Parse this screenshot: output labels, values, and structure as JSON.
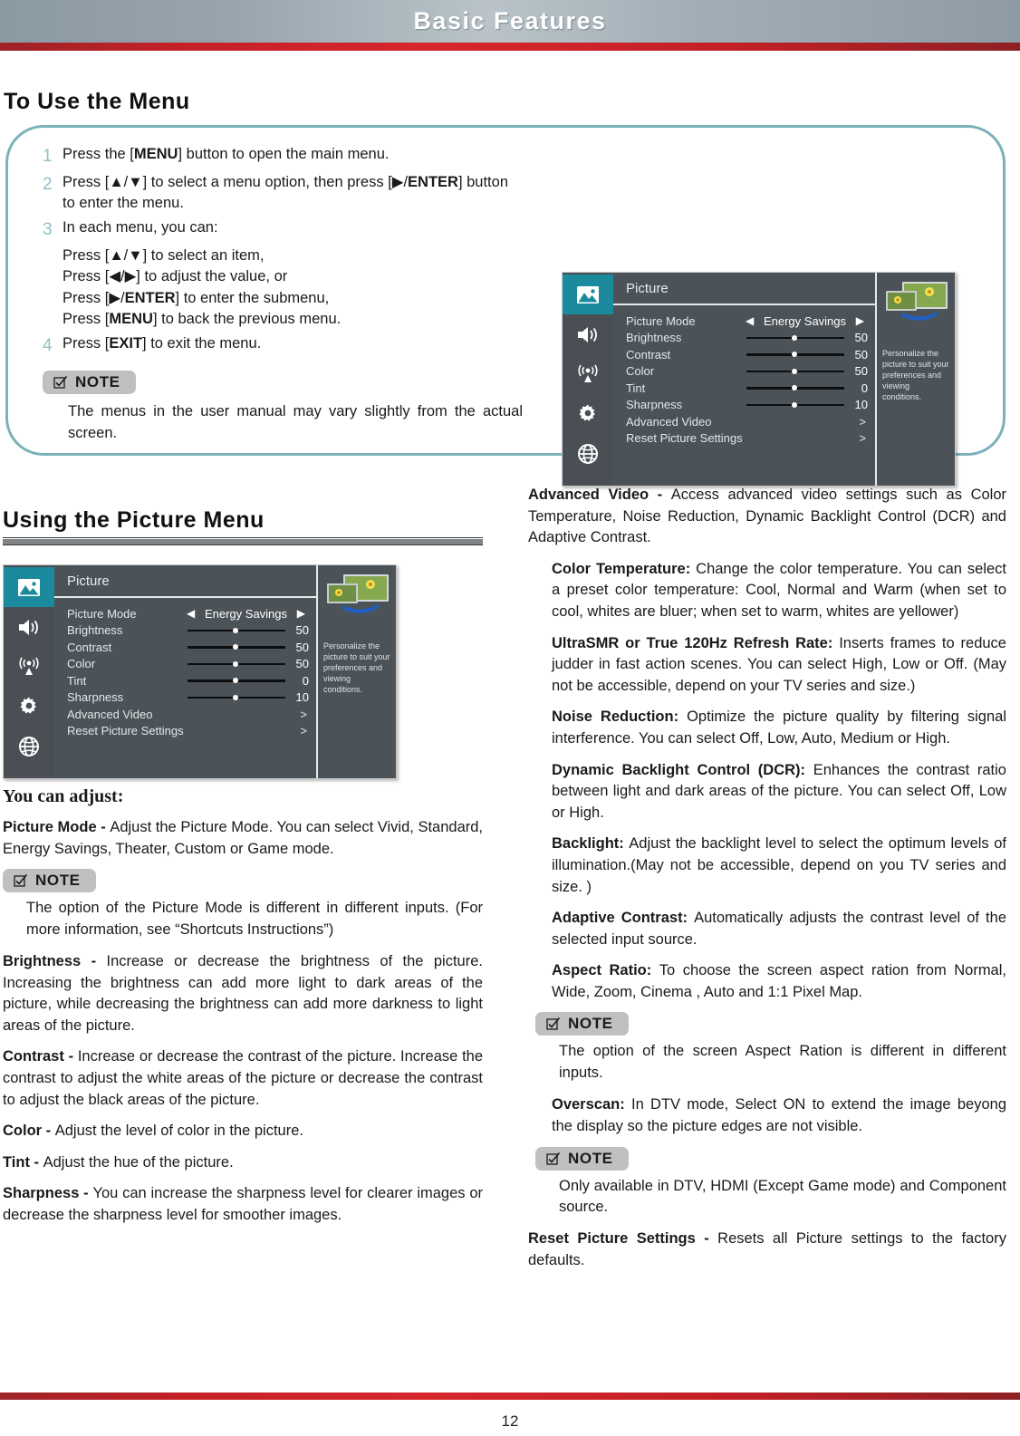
{
  "header": {
    "title": "Basic Features"
  },
  "sections": {
    "to_use_the_menu": "To Use the Menu",
    "using_the_picture_menu": "Using the Picture Menu"
  },
  "steps": [
    {
      "num": "1",
      "html": "Press the [<b>MENU</b>] button to open the main menu."
    },
    {
      "num": "2",
      "html": "Press [▲/▼] to select a menu option, then press [▶/<b>ENTER</b>] button to enter the menu."
    },
    {
      "num": "3",
      "html": "In each menu, you can:"
    },
    {
      "num": "4",
      "html": "Press [<b>EXIT</b>] to exit the menu."
    }
  ],
  "step3_sublines": [
    "Press [▲/▼] to select an item,",
    "Press [◀/▶] to adjust the value, or",
    "Press [▶/<b>ENTER</b>] to enter the submenu,",
    "Press [<b>MENU</b>] to back the previous menu."
  ],
  "notes": {
    "label": "NOTE",
    "menu_vary": "The menus in the user manual may vary slightly from the actual screen.",
    "picture_mode_inputs": "The option of the Picture Mode is different in different inputs. (For more information, see “Shortcuts Instructions”)",
    "aspect_ratio_inputs": "The option of the screen Aspect Ration is different in different inputs.",
    "overscan_availability": "Only available in DTV, HDMI (Except Game mode) and Component source."
  },
  "osd": {
    "title": "Picture",
    "rail_icons": [
      "picture-icon",
      "volume-icon",
      "antenna-icon",
      "gear-icon",
      "globe-icon"
    ],
    "active_rail_index": 0,
    "rows": [
      {
        "label": "Picture Mode",
        "type": "option",
        "value": "Energy Savings",
        "left_arrow": "◀",
        "right_arrow": "▶"
      },
      {
        "label": "Brightness",
        "type": "slider",
        "value": "50",
        "percent": 47
      },
      {
        "label": "Contrast",
        "type": "slider",
        "value": "50",
        "percent": 47
      },
      {
        "label": "Color",
        "type": "slider",
        "value": "50",
        "percent": 47
      },
      {
        "label": "Tint",
        "type": "slider",
        "value": "0",
        "percent": 47
      },
      {
        "label": "Sharpness",
        "type": "slider",
        "value": "10",
        "percent": 47
      },
      {
        "label": "Advanced Video",
        "type": "submenu",
        "value": ">"
      },
      {
        "label": "Reset Picture Settings",
        "type": "submenu",
        "value": ">"
      }
    ],
    "aside_text": "Personalize the picture to suit your preferences and viewing conditions."
  },
  "left_column": {
    "you_can_adjust": "You can adjust:",
    "picture_mode": {
      "term": "Picture Mode - ",
      "body": "Adjust the Picture Mode. You can select Vivid, Standard, Energy Savings, Theater, Custom or Game mode."
    },
    "brightness": {
      "term": "Brightness - ",
      "body": "Increase or decrease the brightness of the picture. Increasing the brightness can add more light to dark areas of the picture, while decreasing the brightness can add more darkness to light areas of the picture."
    },
    "contrast": {
      "term": "Contrast - ",
      "body": "Increase or decrease the contrast of the picture. Increase the contrast to adjust the white areas of the picture or decrease the contrast to adjust the black areas of the picture."
    },
    "color": {
      "term": "Color - ",
      "body": "Adjust the level of color in the picture."
    },
    "tint": {
      "term": "Tint - ",
      "body": "Adjust the hue of the picture."
    },
    "sharpness": {
      "term": "Sharpness - ",
      "body": "You can increase the sharpness level for clearer images or decrease the sharpness level for smoother images."
    }
  },
  "right_column": {
    "advanced_video": {
      "term": "Advanced Video - ",
      "body": "Access advanced video settings such as Color Temperature, Noise Reduction, Dynamic Backlight Control (DCR) and Adaptive Contrast."
    },
    "color_temperature": {
      "term": "Color Temperature: ",
      "body": "Change the color temperature. You can select a preset color temperature: Cool, Normal and Warm (when set to cool, whites are bluer; when set to warm, whites are yellower)"
    },
    "ultrasmr": {
      "term": "UltraSMR or True 120Hz Refresh Rate: ",
      "body": "Inserts frames to reduce judder in fast action scenes. You can select High, Low or Off. (May not be accessible, depend on your TV series and size.)"
    },
    "noise_reduction": {
      "term": "Noise Reduction: ",
      "body": "Optimize the picture quality by filtering signal interference. You can select Off, Low, Auto, Medium or High."
    },
    "dcr": {
      "term": "Dynamic Backlight Control (DCR): ",
      "body": "Enhances the contrast ratio between light and dark areas of the picture. You can select Off, Low or High."
    },
    "backlight": {
      "term": "Backlight: ",
      "body": "Adjust the backlight level to select the optimum levels of illumination.(May not be accessible, depend on you TV series and size. )"
    },
    "adaptive_contrast": {
      "term": "Adaptive Contrast: ",
      "body": "Automatically adjusts the contrast level of the selected input source."
    },
    "aspect_ratio": {
      "term": "Aspect Ratio: ",
      "body": "To choose the screen aspect ration from Normal, Wide, Zoom, Cinema , Auto and 1:1 Pixel Map."
    },
    "overscan": {
      "term": "Overscan: ",
      "body": "In DTV mode, Select ON to extend the image beyong the display so the picture edges are not visible."
    },
    "reset_picture_settings": {
      "term": "Reset Picture Settings - ",
      "body": "Resets all  Picture settings to the factory defaults."
    }
  },
  "footer": {
    "page_number": "12"
  },
  "colors": {
    "accent_teal": "#7bb2b9",
    "osd_active_teal": "#1b8a9c",
    "rule_red": "#c42127",
    "header_gray": "#98a4ad",
    "step_number": "#8fc0c6",
    "note_badge_bg": "#c0c0c0"
  }
}
